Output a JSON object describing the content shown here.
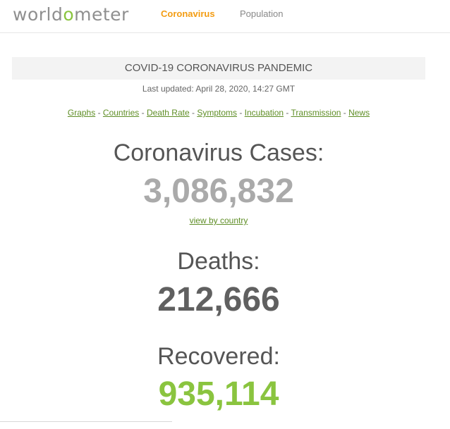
{
  "header": {
    "logo_prefix": "world",
    "logo_o": "o",
    "logo_suffix": "meter",
    "nav": {
      "coronavirus": "Coronavirus",
      "population": "Population"
    }
  },
  "main": {
    "title": "COVID-19 CORONAVIRUS PANDEMIC",
    "last_updated": "Last updated: April 28, 2020, 14:27 GMT",
    "links": [
      "Graphs",
      "Countries",
      "Death Rate",
      "Symptoms",
      "Incubation",
      "Transmission",
      "News"
    ],
    "separator": " - ",
    "cases_label": "Coronavirus Cases:",
    "cases_value": "3,086,832",
    "view_by_country": "view by country",
    "deaths_label": "Deaths:",
    "deaths_value": "212,666",
    "recovered_label": "Recovered:",
    "recovered_value": "935,114"
  },
  "colors": {
    "accent_orange": "#f39c12",
    "link_green": "#5f8e26",
    "recovered_green": "#8ac43f",
    "cases_gray": "#aaaaaa",
    "deaths_gray": "#606060"
  }
}
